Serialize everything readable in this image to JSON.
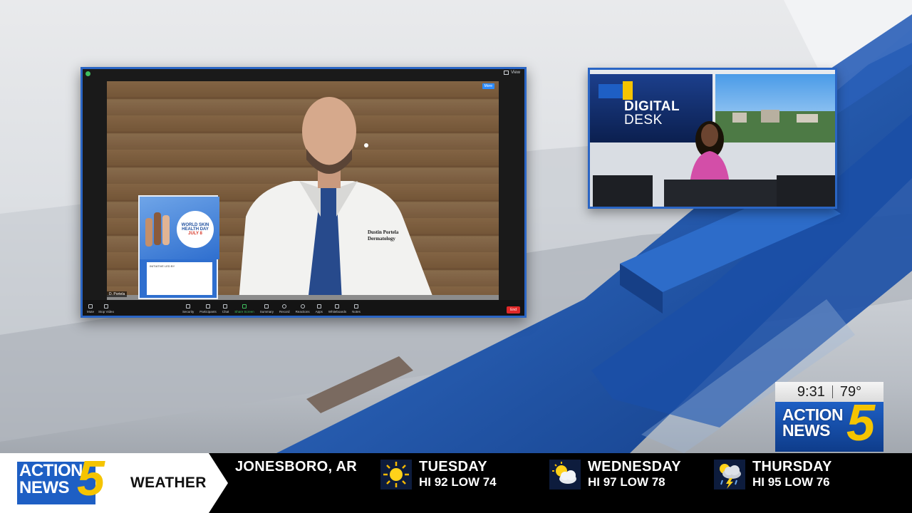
{
  "zoom": {
    "view_label": "View",
    "layout_label": "More",
    "participant_name": "D. Portela",
    "toolbar_left": [
      {
        "label": "Mute"
      },
      {
        "label": "Stop Video"
      }
    ],
    "toolbar_mid": [
      {
        "label": "Security"
      },
      {
        "label": "Participants"
      },
      {
        "label": "Chat"
      },
      {
        "label": "Share Screen"
      },
      {
        "label": "Summary"
      },
      {
        "label": "Record"
      },
      {
        "label": "Reactions"
      },
      {
        "label": "Apps"
      },
      {
        "label": "Whiteboards"
      },
      {
        "label": "Notes"
      }
    ],
    "end_label": "End",
    "coat_text_1": "Dustin Portela",
    "coat_text_2": "Dermatology",
    "sign_title_1": "WORLD SKIN",
    "sign_title_2": "HEALTH DAY",
    "sign_title_3": "JULY 8",
    "sign_small": "INITIATIVE LED BY"
  },
  "digital_desk": {
    "line1": "DIGITAL",
    "line2": "DESK"
  },
  "bug": {
    "time": "9:31",
    "temp": "79°",
    "logo_line1": "ACTION",
    "logo_line2": "NEWS",
    "logo_number": "5"
  },
  "ticker": {
    "logo_line1": "ACTION",
    "logo_line2": "NEWS",
    "logo_number": "5",
    "segment_label": "WEATHER",
    "location": "JONESBORO, AR",
    "days": [
      {
        "name": "TUESDAY",
        "hilo": "HI 92 LOW 74",
        "icon": "sun-icon"
      },
      {
        "name": "WEDNESDAY",
        "hilo": "HI 97 LOW 78",
        "icon": "partly-cloudy-icon"
      },
      {
        "name": "THURSDAY",
        "hilo": "HI 95 LOW 76",
        "icon": "thunderstorm-icon"
      }
    ]
  },
  "colors": {
    "brand_blue": "#1e5fc4",
    "brand_yellow": "#f5c400",
    "frame_blue": "#2a65c4"
  }
}
